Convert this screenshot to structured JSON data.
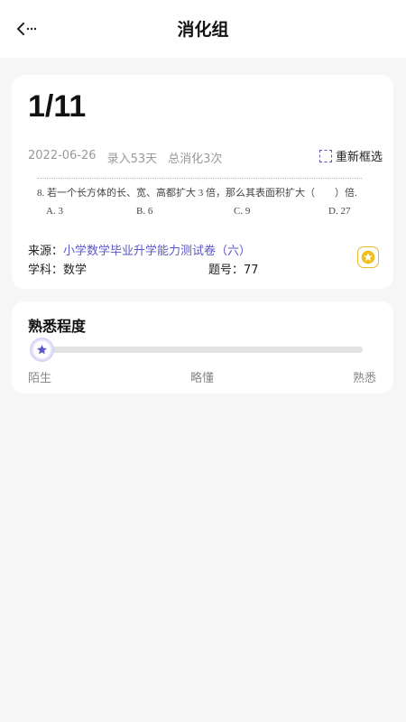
{
  "header": {
    "title": "消化组"
  },
  "card": {
    "counter": "1/11",
    "date": "2022-06-26",
    "entered": "录入53天",
    "digest_count": "总消化3次",
    "reselect_label": "重新框选",
    "question": {
      "stem": "8. 若一个长方体的长、宽、高都扩大 3 倍，那么其表面积扩大（　　）倍.",
      "options": [
        "A. 3",
        "B. 6",
        "C. 9",
        "D. 27"
      ]
    },
    "source_label": "来源：",
    "source_value": "小学数学毕业升学能力测试卷（六）",
    "subject_label": "学科：",
    "subject_value": "数学",
    "qnum_label": "题号：",
    "qnum_value": "77"
  },
  "familiarity": {
    "title": "熟悉程度",
    "level": 0,
    "labels": [
      "陌生",
      "略懂",
      "熟悉"
    ]
  },
  "colors": {
    "accent": "#5b57c9",
    "star": "#f0c020"
  }
}
